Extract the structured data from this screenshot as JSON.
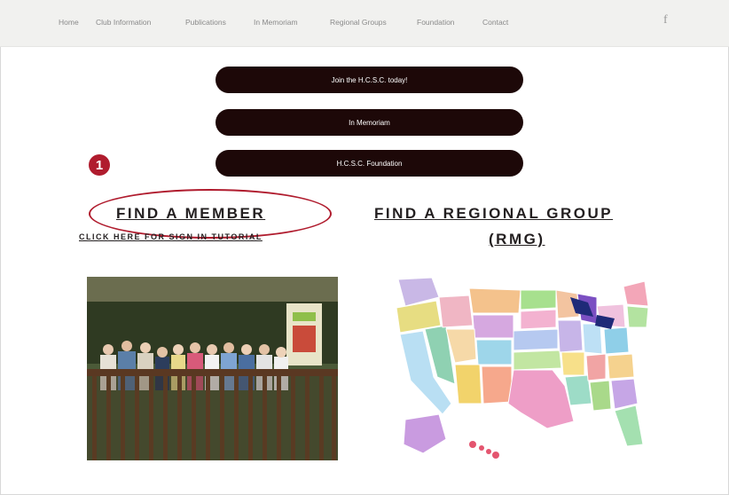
{
  "nav": {
    "items": [
      "Home",
      "Club Information",
      "Publications",
      "In Memoriam",
      "Regional Groups",
      "Foundation",
      "Contact"
    ],
    "social_icon": "facebook-icon"
  },
  "buttons": {
    "join": "Join the H.C.S.C. today!",
    "memoriam": "In Memoriam",
    "foundation": "H.C.S.C. Foundation"
  },
  "annotation": {
    "number": "1",
    "color": "#b01c2e"
  },
  "find_member": {
    "title": "FIND A MEMBER",
    "tutorial": "CLICK HERE FOR SIGN IN TUTORIAL"
  },
  "find_regional": {
    "title_line1": "FIND A REGIONAL GROUP",
    "title_line2": "(RMG)"
  },
  "colors": {
    "button_bg": "#1d0808",
    "nav_bg": "#f1f1ef",
    "heading": "#231f20"
  }
}
